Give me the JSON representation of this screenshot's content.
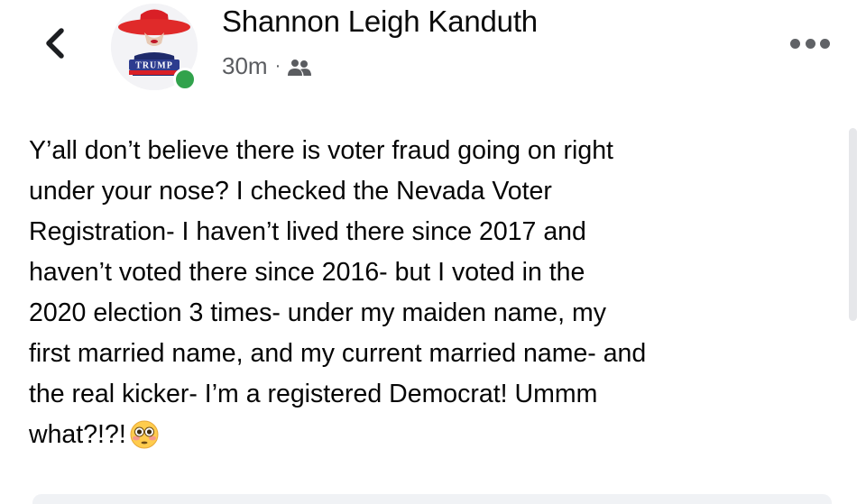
{
  "post": {
    "author_name": "Shannon Leigh Kanduth",
    "timestamp": "30m",
    "separator": "·",
    "audience_icon": "friends-icon",
    "avatar_badge_text": "TRUMP",
    "body_text": "Y’all don’t believe there is voter fraud going on right\nunder your nose? I checked the Nevada Voter\nRegistration- I haven’t lived there since 2017 and\nhaven’t voted there since 2016- but I voted in the\n2020 election 3 times- under my maiden name, my\nfirst married name, and my current married name- and\nthe real kicker- I’m a registered Democrat! Ummm\nwhat?!?!",
    "emoji": "flushed-face-emoji"
  },
  "icons": {
    "back": "chevron-left-icon",
    "more": "more-options-icon"
  },
  "colors": {
    "online_status": "#31a24c",
    "secondary_text": "#5a5c60",
    "primary_text": "#050505",
    "hat_red": "#e02a2a"
  }
}
